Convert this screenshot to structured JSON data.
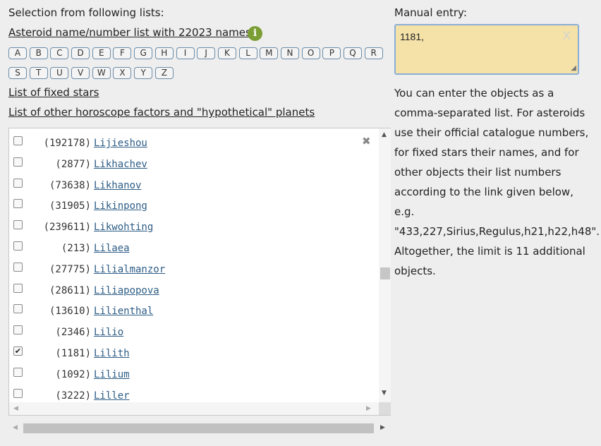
{
  "left": {
    "heading": "Selection from following lists:",
    "asteroid_list_link": "Asteroid name/number list with 22023 names",
    "info_icon_glyph": "i",
    "letters_row1": [
      "A",
      "B",
      "C",
      "D",
      "E",
      "F",
      "G",
      "H",
      "I",
      "J",
      "K",
      "L",
      "M",
      "N",
      "O",
      "P",
      "Q",
      "R"
    ],
    "letters_row2": [
      "S",
      "T",
      "U",
      "V",
      "W",
      "X",
      "Y",
      "Z"
    ],
    "fixed_stars_link": "List of fixed stars",
    "other_factors_link": "List of other horoscope factors and \"hypothetical\" planets",
    "close_glyph": "✖",
    "rows": [
      {
        "num": "(192178)",
        "name": "Lijieshou",
        "checked": false
      },
      {
        "num": "(2877)",
        "name": "Likhachev",
        "checked": false
      },
      {
        "num": "(73638)",
        "name": "Likhanov",
        "checked": false
      },
      {
        "num": "(31905)",
        "name": "Likinpong",
        "checked": false
      },
      {
        "num": "(239611)",
        "name": "Likwohting",
        "checked": false
      },
      {
        "num": "(213)",
        "name": "Lilaea",
        "checked": false
      },
      {
        "num": "(27775)",
        "name": "Lilialmanzor",
        "checked": false
      },
      {
        "num": "(28611)",
        "name": "Liliapopova",
        "checked": false
      },
      {
        "num": "(13610)",
        "name": "Lilienthal",
        "checked": false
      },
      {
        "num": "(2346)",
        "name": "Lilio",
        "checked": false
      },
      {
        "num": "(1181)",
        "name": "Lilith",
        "checked": true
      },
      {
        "num": "(1092)",
        "name": "Lilium",
        "checked": false
      },
      {
        "num": "(3222)",
        "name": "Liller",
        "checked": false
      }
    ]
  },
  "right": {
    "heading": "Manual entry:",
    "manual_value": "1181,",
    "clear_glyph": "X",
    "help_text": "You can enter the objects as a comma-separated list. For asteroids use their official catalogue numbers, for fixed stars their names, and for other objects their list numbers according to the link given below, e.g. \"433,227,Sirius,Regulus,h21,h22,h48\". Altogether, the limit is 11 additional objects."
  }
}
